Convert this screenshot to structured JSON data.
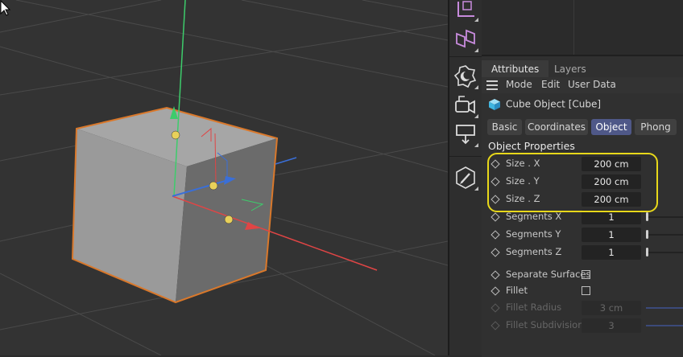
{
  "attributes_panel": {
    "tabs": [
      {
        "label": "Attributes",
        "active": true
      },
      {
        "label": "Layers",
        "active": false
      }
    ],
    "menu": [
      "Mode",
      "Edit",
      "User Data"
    ],
    "object_title": "Cube Object [Cube]",
    "property_tabs": [
      {
        "label": "Basic",
        "active": false
      },
      {
        "label": "Coordinates",
        "active": false
      },
      {
        "label": "Object",
        "active": true
      },
      {
        "label": "Phong",
        "active": false
      }
    ],
    "section_title": "Object Properties",
    "properties": [
      {
        "label": "Size . X",
        "value": "200 cm"
      },
      {
        "label": "Size . Y",
        "value": "200 cm"
      },
      {
        "label": "Size . Z",
        "value": "200 cm"
      },
      {
        "label": "Segments X",
        "value": "1"
      },
      {
        "label": "Segments Y",
        "value": "1"
      },
      {
        "label": "Segments Z",
        "value": "1"
      }
    ],
    "checkboxes": [
      {
        "label": "Separate Surfaces",
        "checked": false
      },
      {
        "label": "Fillet",
        "checked": false
      }
    ],
    "disabled_properties": [
      {
        "label": "Fillet Radius",
        "value": "3 cm"
      },
      {
        "label": "Fillet Subdivision",
        "value": "3"
      }
    ]
  },
  "toolbar_icons": [
    "axis-mode-icon",
    "polygon-pen-icon",
    "environment-icon",
    "camera-icon",
    "deformer-icon",
    "sketch-pencil-icon"
  ],
  "colors": {
    "accent_active_tab": "#4f5888",
    "highlight_outline": "#e8d81a",
    "selection_outline": "#d9782b",
    "axis_x": "#e04545",
    "axis_y": "#3dcc6b",
    "axis_z": "#3a6fd8"
  }
}
